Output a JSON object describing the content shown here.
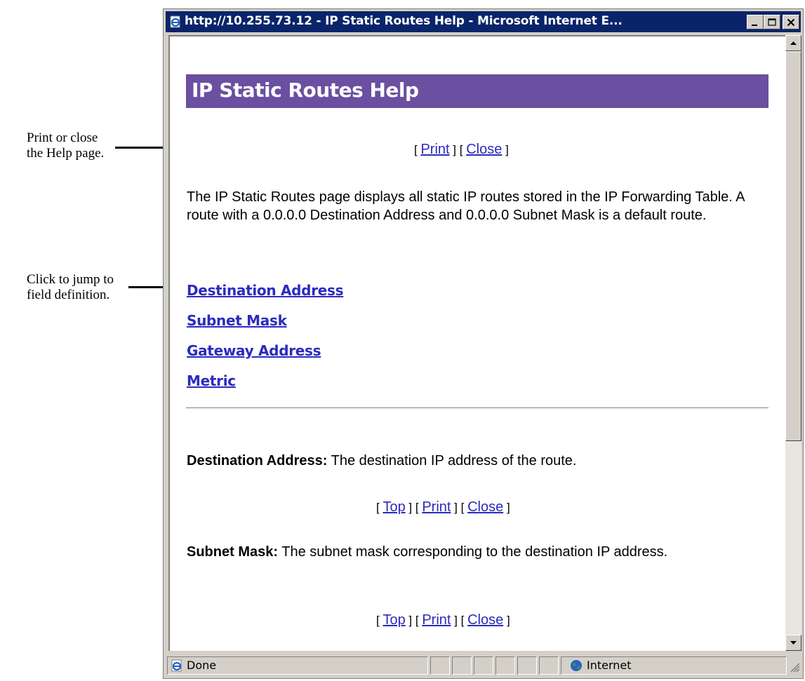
{
  "annotations": {
    "print_close_note": [
      "Print or close",
      "the Help page."
    ],
    "jump_note": [
      "Click to jump to",
      "field definition."
    ]
  },
  "window": {
    "title": "http://10.255.73.12 - IP Static Routes Help - Microsoft Internet E...",
    "icon": "ie-page-icon",
    "controls": [
      "minimize-icon",
      "maximize-icon",
      "close-icon"
    ]
  },
  "page": {
    "heading": "IP Static Routes Help",
    "top_links": {
      "print": "Print",
      "close": "Close"
    },
    "intro": "The IP Static Routes page displays all static IP routes stored in the IP Forwarding Table. A route with a 0.0.0.0 Destination Address and 0.0.0.0 Subnet Mask is a default route.",
    "field_links": [
      "Destination Address",
      "Subnet Mask",
      "Gateway Address",
      "Metric"
    ],
    "definitions": [
      {
        "term": "Destination Address:",
        "text": " The destination IP address of the route."
      },
      {
        "term": "Subnet Mask:",
        "text": " The subnet mask corresponding to the destination IP address."
      }
    ],
    "nav_links": {
      "top": "Top",
      "print": "Print",
      "close": "Close"
    }
  },
  "status_bar": {
    "status": "Done",
    "zone": "Internet"
  },
  "colors": {
    "banner": "#6b4fa0",
    "titlebar": "#0a246a",
    "link": "#2b2bbf"
  }
}
